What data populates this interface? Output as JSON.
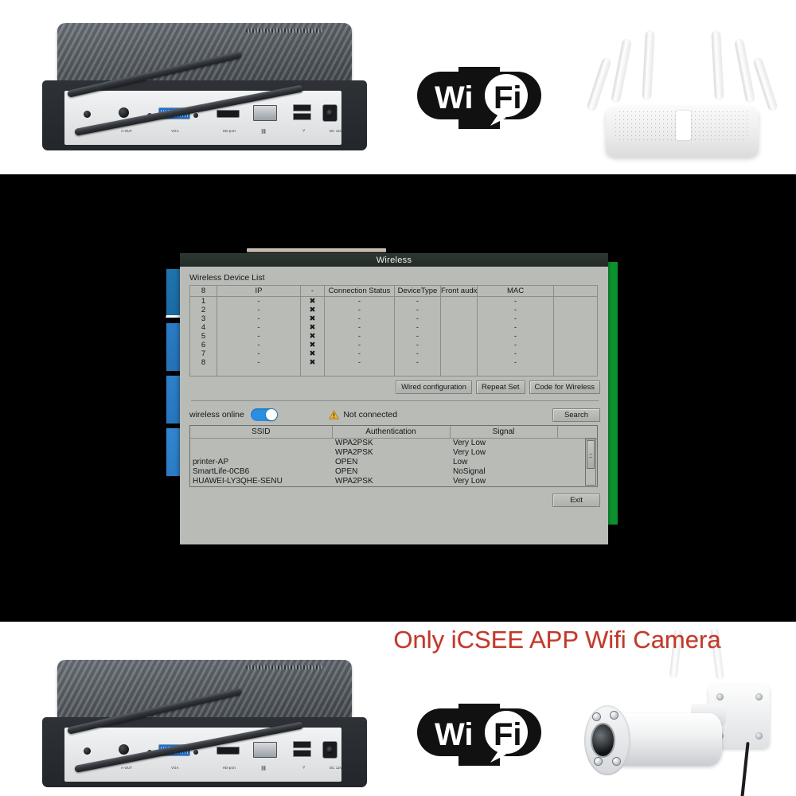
{
  "product": {
    "headline": "Only iCSEE APP Wifi Camera",
    "headline_color": "#c0392b",
    "wifi_logo_text_1": "Wi",
    "wifi_logo_text_2": "Fi",
    "nvr_port_labels": [
      "⏻",
      "A-OUT",
      "VGA",
      "HD-port",
      "⛓",
      "⑂",
      "DC 12V"
    ],
    "nvr_port_names": [
      "power",
      "audio-out",
      "vga",
      "hdmi",
      "lan",
      "usb",
      "dc-12v"
    ]
  },
  "dialog": {
    "title": "Wireless",
    "device_list_label": "Wireless Device List",
    "device_table": {
      "headers": [
        "8",
        "IP",
        "-",
        "Connection Status",
        "DeviceType",
        "Front audio",
        "MAC",
        ""
      ],
      "rows": [
        {
          "no": "1",
          "ip": "-",
          "x": "✖",
          "status": "-",
          "type": "-",
          "audio": "",
          "mac": "-",
          "extra": ""
        },
        {
          "no": "2",
          "ip": "-",
          "x": "✖",
          "status": "-",
          "type": "-",
          "audio": "",
          "mac": "-",
          "extra": ""
        },
        {
          "no": "3",
          "ip": "-",
          "x": "✖",
          "status": "-",
          "type": "-",
          "audio": "",
          "mac": "-",
          "extra": ""
        },
        {
          "no": "4",
          "ip": "-",
          "x": "✖",
          "status": "-",
          "type": "-",
          "audio": "",
          "mac": "-",
          "extra": ""
        },
        {
          "no": "5",
          "ip": "-",
          "x": "✖",
          "status": "-",
          "type": "-",
          "audio": "",
          "mac": "-",
          "extra": ""
        },
        {
          "no": "6",
          "ip": "-",
          "x": "✖",
          "status": "-",
          "type": "-",
          "audio": "",
          "mac": "-",
          "extra": ""
        },
        {
          "no": "7",
          "ip": "-",
          "x": "✖",
          "status": "-",
          "type": "-",
          "audio": "",
          "mac": "-",
          "extra": ""
        },
        {
          "no": "8",
          "ip": "-",
          "x": "✖",
          "status": "-",
          "type": "-",
          "audio": "",
          "mac": "-",
          "extra": ""
        }
      ]
    },
    "buttons": {
      "wired_configuration": "Wired configuration",
      "repeat_set": "Repeat Set",
      "code_for_wireless": "Code for Wireless",
      "search": "Search",
      "exit": "Exit"
    },
    "wireless_online_label": "wireless online",
    "wireless_online_state": "on",
    "connection_status_text": "Not connected",
    "ssid_table": {
      "headers": [
        "SSID",
        "Authentication",
        "Signal",
        ""
      ],
      "rows": [
        {
          "ssid": "",
          "auth": "WPA2PSK",
          "signal": "Very Low"
        },
        {
          "ssid": "",
          "auth": "WPA2PSK",
          "signal": "Very Low"
        },
        {
          "ssid": "printer-AP",
          "auth": "OPEN",
          "signal": "Low"
        },
        {
          "ssid": "SmartLife-0CB6",
          "auth": "OPEN",
          "signal": "NoSignal"
        },
        {
          "ssid": "HUAWEI-LY3QHE-SENU",
          "auth": "WPA2PSK",
          "signal": "Very Low"
        }
      ]
    }
  },
  "colors": {
    "toggle_on": "#2a8fe0",
    "warning": "#e8b43a",
    "x_mark": "#b21f1f",
    "dialog_bg": "#b9bbb6",
    "titlebar": "#2e3832",
    "green_strip": "#0f9e34",
    "channel_blue": "#2a7cc4"
  }
}
